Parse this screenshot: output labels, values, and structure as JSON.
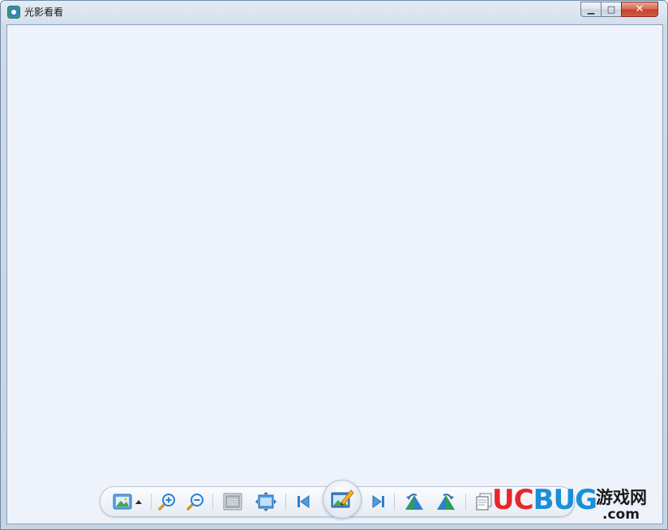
{
  "window": {
    "title": "光影看看",
    "caption": {
      "minimize": "▁",
      "maximize": "□",
      "close": "✕"
    }
  },
  "colors": {
    "content_bg": "#eef3fb",
    "accent_blue": "#2f7fd0",
    "close_red": "#c4412a",
    "watermark_red": "#e8262a",
    "watermark_blue": "#1a8fd8"
  },
  "toolbar": {
    "buttons": [
      {
        "name": "image-menu",
        "icon": "picture-icon"
      },
      {
        "name": "dropdown",
        "icon": "caret-up-icon"
      },
      {
        "name": "zoom-in",
        "icon": "zoom-in-icon"
      },
      {
        "name": "zoom-out",
        "icon": "zoom-out-icon"
      },
      {
        "name": "fit-window",
        "icon": "fit-window-icon"
      },
      {
        "name": "actual-size",
        "icon": "actual-size-icon"
      },
      {
        "name": "previous",
        "icon": "previous-icon"
      },
      {
        "name": "edit",
        "icon": "edit-image-icon"
      },
      {
        "name": "next",
        "icon": "next-icon"
      },
      {
        "name": "rotate-left",
        "icon": "rotate-left-icon"
      },
      {
        "name": "rotate-right",
        "icon": "rotate-right-icon"
      },
      {
        "name": "copy",
        "icon": "copy-icon"
      }
    ]
  },
  "watermark": {
    "letters": [
      "U",
      "C",
      "B",
      "U",
      "G"
    ],
    "chinese": "游戏网",
    "domain": ".com"
  }
}
